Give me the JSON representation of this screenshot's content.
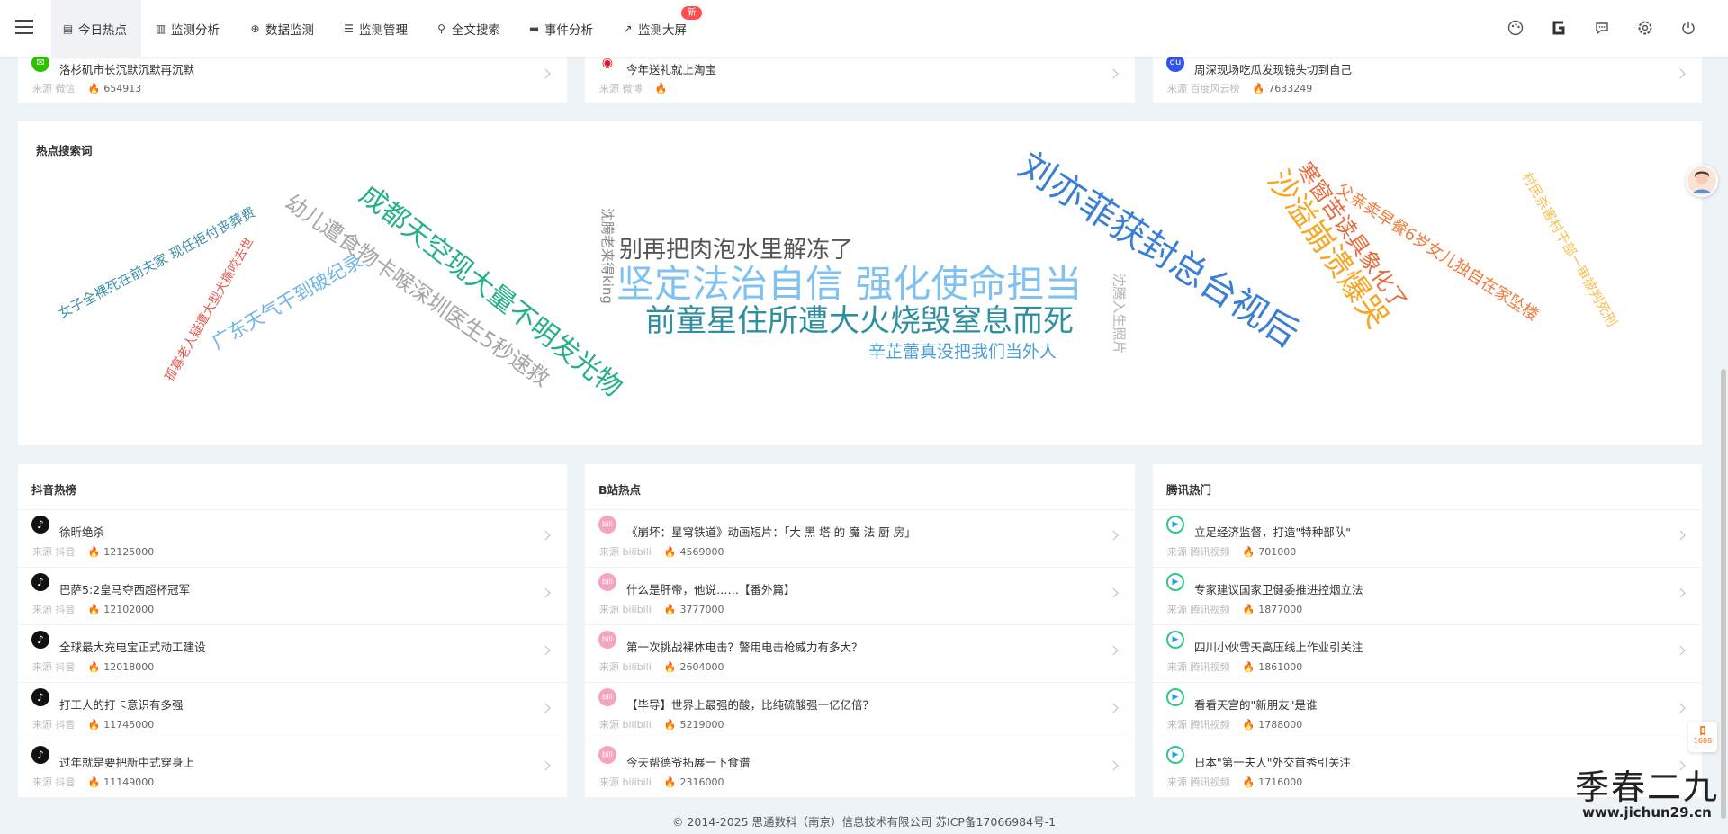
{
  "nav": {
    "tabs": [
      {
        "label": "今日热点",
        "icon": "document-icon"
      },
      {
        "label": "监测分析",
        "icon": "bar-chart-icon"
      },
      {
        "label": "数据监测",
        "icon": "crosshair-icon"
      },
      {
        "label": "监测管理",
        "icon": "list-icon"
      },
      {
        "label": "全文搜索",
        "icon": "search-icon"
      },
      {
        "label": "事件分析",
        "icon": "card-icon"
      },
      {
        "label": "监测大屏",
        "icon": "line-chart-icon"
      }
    ],
    "new_badge": "新",
    "right_icons": [
      "palette-icon",
      "g-logo-icon",
      "chat-icon",
      "gear-icon",
      "power-icon"
    ]
  },
  "top_cards": [
    {
      "title": "洛杉矶市长沉默沉默再沉默",
      "source": "来源 微信",
      "count": "654913",
      "icon": "wechat-icon"
    },
    {
      "title": "今年送礼就上淘宝",
      "source": "来源 微博",
      "count": "",
      "icon": "weibo-icon"
    },
    {
      "title": "周深现场吃瓜发现镜头切到自己",
      "source": "来源 百度风云榜",
      "count": "7633249",
      "icon": "baidu-icon"
    }
  ],
  "wordcloud": {
    "title": "热点搜索词",
    "words": [
      "女子全裸死在前夫家 现任拒付丧葬费",
      "孤寡老人疑遭大型犬撕咬去世",
      "广东天气干到破纪录",
      "幼儿遭食物卡喉深圳医生5秒速救",
      "成都天空现大量不明发光物",
      "沈腾老来得king",
      "别再把肉泡水里解冻了",
      "坚定法治自信 强化使命担当",
      "前童星住所遭大火烧毁窒息而死",
      "辛芷蕾真没把我们当外人",
      "沈腾入生照片",
      "刘亦菲获封总台视后",
      "沙溢崩溃爆哭",
      "寒窗苦读具象化了",
      "父亲卖早餐6岁女儿独自在家坠楼",
      "村民杀害村干部一审被判死刑"
    ]
  },
  "lists": [
    {
      "title": "抖音热榜",
      "source": "来源 抖音",
      "icon": "douyin-icon",
      "items": [
        {
          "text": "徐昕绝杀",
          "count": "12125000"
        },
        {
          "text": "巴萨5:2皇马夺西超杯冠军",
          "count": "12102000"
        },
        {
          "text": "全球最大充电宝正式动工建设",
          "count": "12018000"
        },
        {
          "text": "打工人的打卡意识有多强",
          "count": "11745000"
        },
        {
          "text": "过年就是要把新中式穿身上",
          "count": "11149000"
        }
      ]
    },
    {
      "title": "B站热点",
      "source": "来源 bilibili",
      "icon": "bilibili-icon",
      "items": [
        {
          "text": "《崩坏：星穹铁道》动画短片：「大 黑 塔 的 魔 法 厨 房」",
          "count": "4569000"
        },
        {
          "text": "什么是肝帝，他说……【番外篇】",
          "count": "3777000"
        },
        {
          "text": "第一次挑战裸体电击？警用电击枪威力有多大？",
          "count": "2604000"
        },
        {
          "text": "【毕导】世界上最强的酸，比纯硫酸强一亿亿倍？",
          "count": "5219000"
        },
        {
          "text": "今天帮德爷拓展一下食谱",
          "count": "2316000"
        }
      ]
    },
    {
      "title": "腾讯热门",
      "source": "来源 腾讯视频",
      "icon": "tencent-video-icon",
      "items": [
        {
          "text": "立足经济监督，打造\"特种部队\"",
          "count": "701000"
        },
        {
          "text": "专家建议国家卫健委推进控烟立法",
          "count": "1877000"
        },
        {
          "text": "四川小伙雪天高压线上作业引关注",
          "count": "1861000"
        },
        {
          "text": "看看天宫的\"新朋友\"是谁",
          "count": "1788000"
        },
        {
          "text": "日本\"第一夫人\"外交首秀引关注",
          "count": "1716000"
        }
      ]
    }
  ],
  "footer": "© 2014-2025 思通数科（南京）信息技术有限公司 苏ICP备17066984号-1",
  "watermark": {
    "big": "季春二九",
    "url": "www.jichun29.cn"
  },
  "widgets": {
    "ali_label": "1688"
  }
}
